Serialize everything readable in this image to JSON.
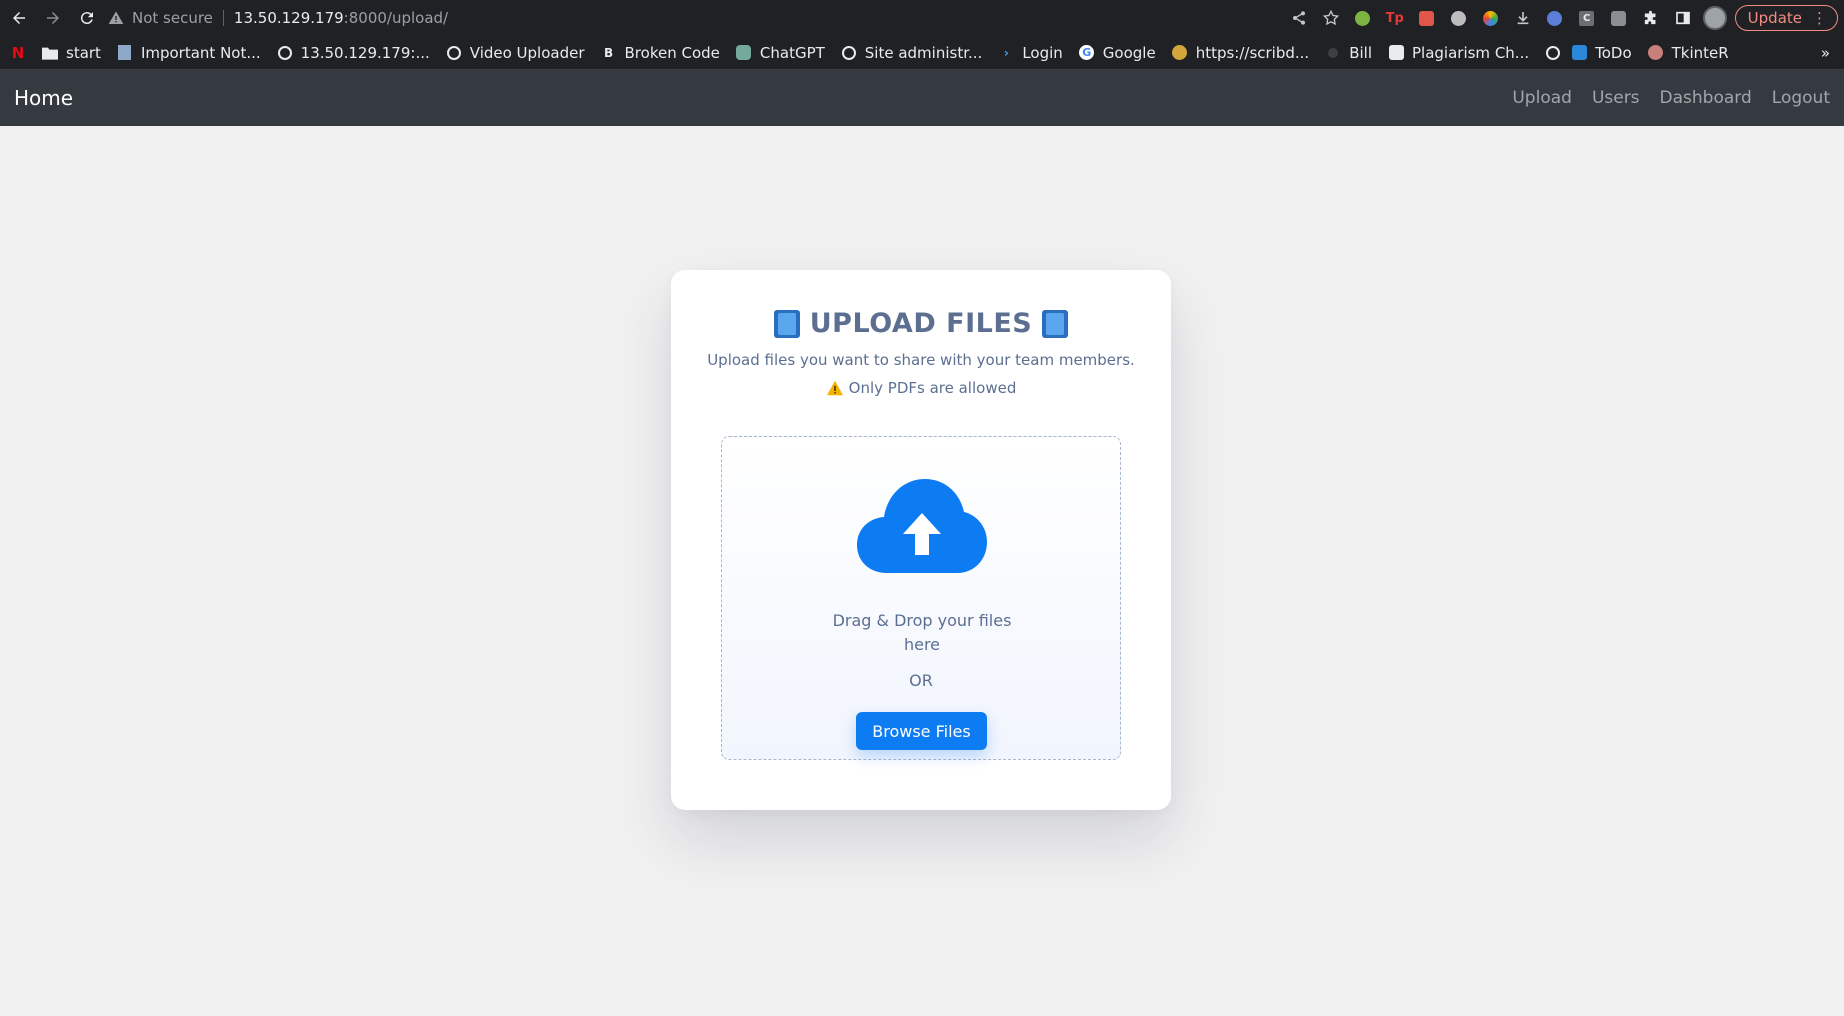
{
  "browser": {
    "security_label": "Not secure",
    "url_host": "13.50.129.179",
    "url_path": ":8000/upload/",
    "update_label": "Update",
    "bookmarks": [
      {
        "label": "",
        "icon": "netflix-icon"
      },
      {
        "label": "start",
        "icon": "folder-icon"
      },
      {
        "label": "Important Not...",
        "icon": "notes-icon"
      },
      {
        "label": "13.50.129.179:...",
        "icon": "globe-icon"
      },
      {
        "label": "Video Uploader",
        "icon": "globe-icon"
      },
      {
        "label": "Broken Code",
        "icon": "code-icon"
      },
      {
        "label": "ChatGPT",
        "icon": "chatgpt-icon"
      },
      {
        "label": "Site administr...",
        "icon": "globe-icon"
      },
      {
        "label": "Login",
        "icon": "login-icon"
      },
      {
        "label": "Google",
        "icon": "google-icon"
      },
      {
        "label": "https://scribd...",
        "icon": "scribd-icon"
      },
      {
        "label": "Bill",
        "icon": "bill-icon"
      },
      {
        "label": "Plagiarism Ch...",
        "icon": "plagiarism-icon"
      },
      {
        "label": "",
        "icon": "globe-icon"
      },
      {
        "label": "ToDo",
        "icon": "todo-icon"
      },
      {
        "label": "TkinteR",
        "icon": "tkinter-icon"
      }
    ],
    "more_label": "»"
  },
  "navbar": {
    "brand": "Home",
    "links": [
      "Upload",
      "Users",
      "Dashboard",
      "Logout"
    ]
  },
  "card": {
    "title": "UPLOAD FILES",
    "subtitle": "Upload files you want to share with your team members.",
    "note": "Only PDFs are allowed",
    "drop_text": "Drag & Drop your files here",
    "or_text": "OR",
    "browse_label": "Browse Files"
  },
  "colors": {
    "navbar_bg": "#343a40",
    "accent": "#0d7cf2",
    "text_muted": "#5c6f91",
    "page_bg": "#f1f1f1"
  }
}
